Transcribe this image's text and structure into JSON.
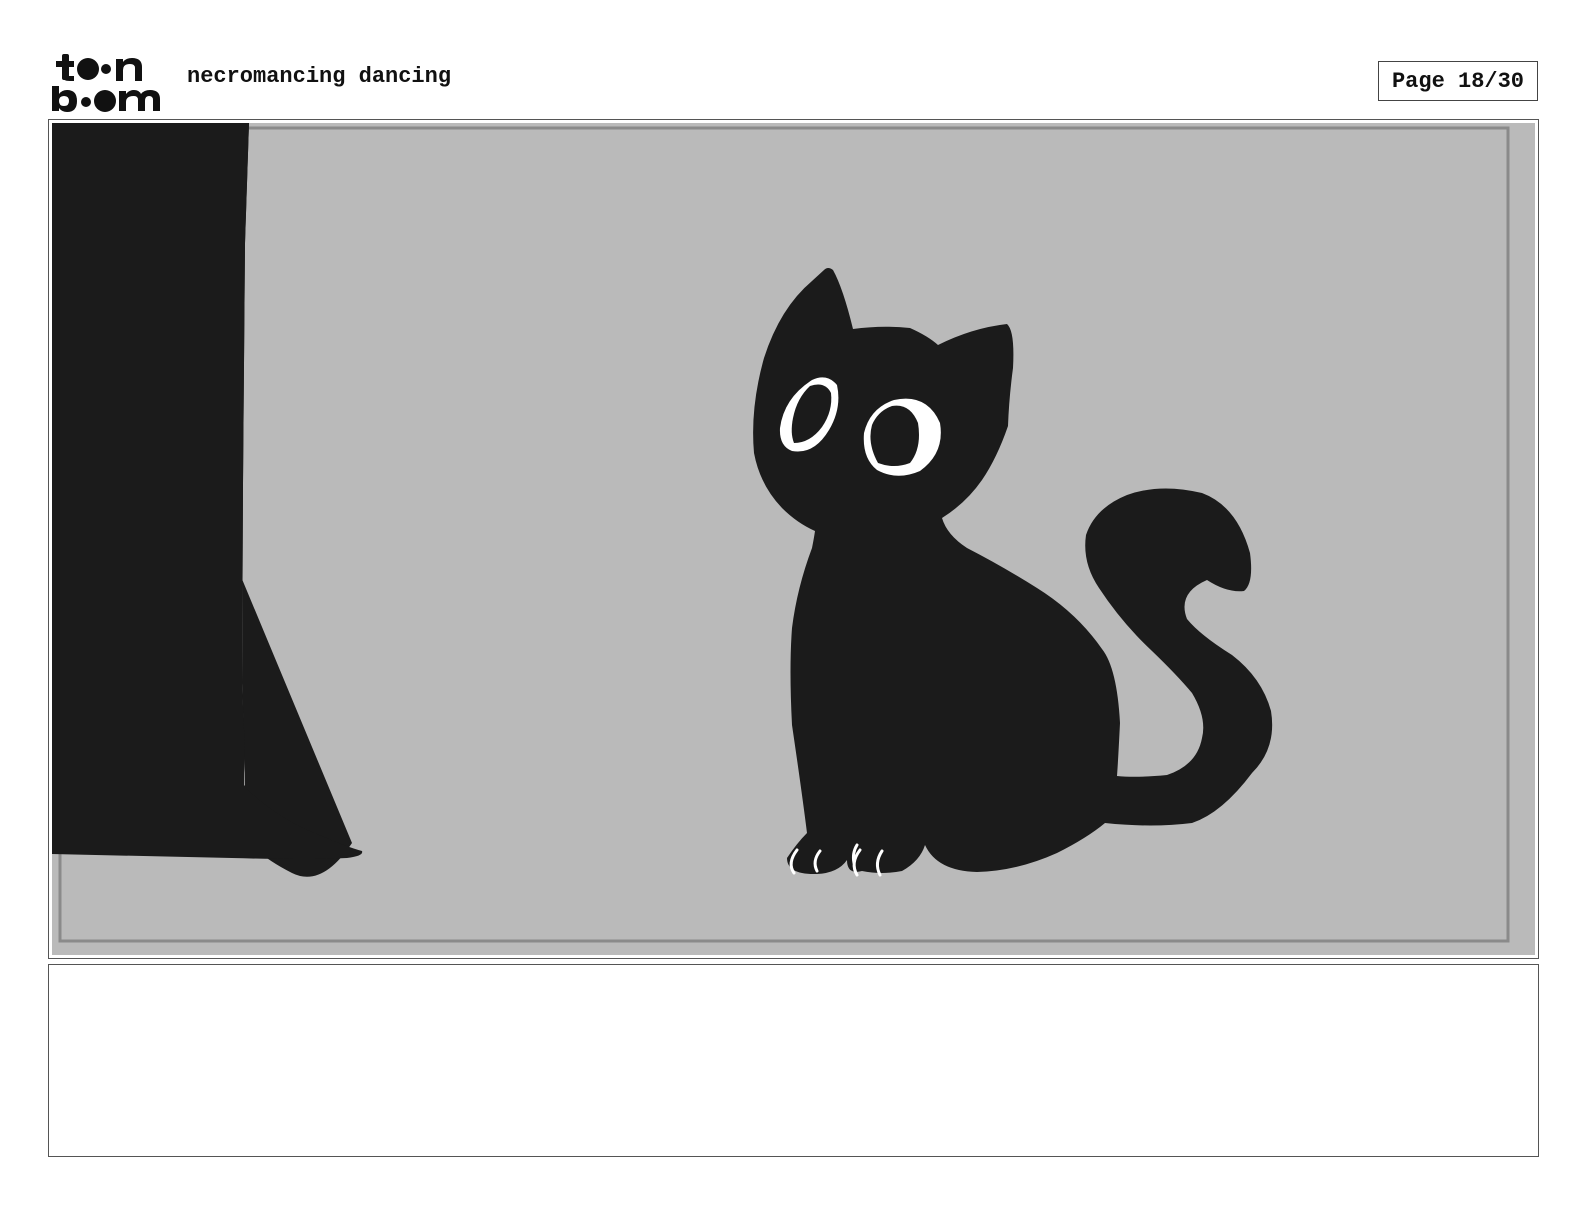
{
  "header": {
    "logo_text": "toon boom",
    "project_title": "necromancing dancing",
    "page_label": "Page 18/30"
  },
  "panel": {
    "background_color": "#bababa",
    "ink_color": "#1b1b1b",
    "highlight_color": "#ffffff"
  },
  "notes": {
    "text": ""
  }
}
